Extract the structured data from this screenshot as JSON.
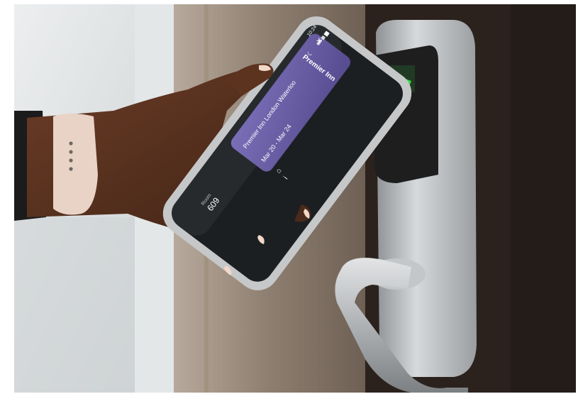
{
  "photo": {
    "subject_icons": [
      "close-icon",
      "signal-icon",
      "wifi-icon",
      "battery-icon",
      "moon-icon",
      "home-icon",
      "info-icon"
    ],
    "colors": {
      "wall": "#dfe2e3",
      "door_frame": "#8c7c6e",
      "door": "#2a211c",
      "lock_metal": "#b6b9bb",
      "lock_light": "#35e04a",
      "phone_case": "#c9c9c9",
      "phone_screen": "#1c1f22",
      "app_card": "#6b5fa8"
    }
  },
  "phone_screen": {
    "status_time": "10:24",
    "app_name": "Premier Inn",
    "hotel_name": "Premier Inn London Waterloo",
    "dates": "Mar 20 - Mar 24",
    "room_label": "Room",
    "room_number": "609"
  }
}
